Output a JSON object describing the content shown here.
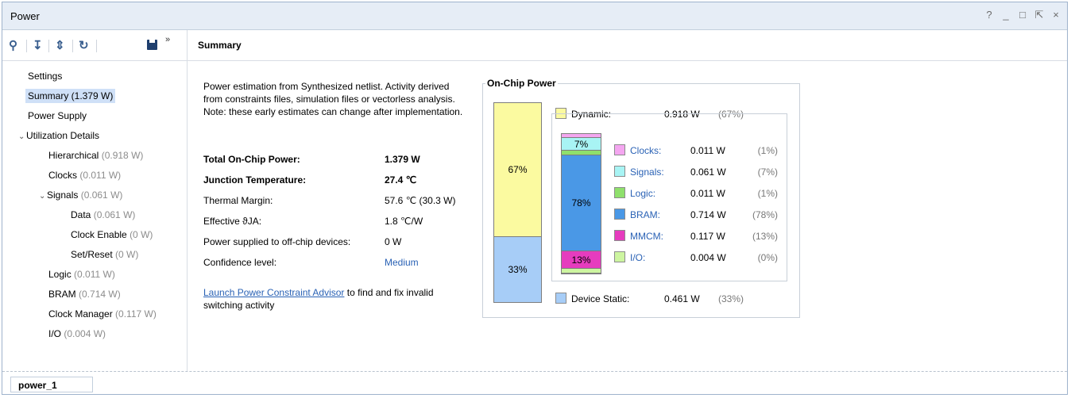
{
  "window": {
    "title": "Power",
    "controls": [
      "?",
      "_",
      "□",
      "⇱",
      "×"
    ]
  },
  "main": {
    "header": "Summary"
  },
  "tree": [
    {
      "label": "Settings",
      "sub": ""
    },
    {
      "label": "Summary (1.379 W)",
      "sub": ""
    },
    {
      "label": "Power Supply",
      "sub": ""
    },
    {
      "label": "Utilization Details",
      "sub": ""
    },
    {
      "label": "Hierarchical",
      "sub": "(0.918 W)"
    },
    {
      "label": "Clocks",
      "sub": "(0.011 W)"
    },
    {
      "label": "Signals",
      "sub": "(0.061 W)"
    },
    {
      "label": "Data",
      "sub": "(0.061 W)"
    },
    {
      "label": "Clock Enable",
      "sub": "(0 W)"
    },
    {
      "label": "Set/Reset",
      "sub": "(0 W)"
    },
    {
      "label": "Logic",
      "sub": "(0.011 W)"
    },
    {
      "label": "BRAM",
      "sub": "(0.714 W)"
    },
    {
      "label": "Clock Manager",
      "sub": "(0.117 W)"
    },
    {
      "label": "I/O",
      "sub": "(0.004 W)"
    }
  ],
  "summary": {
    "description": "Power estimation from Synthesized netlist. Activity derived from constraints files, simulation files or vectorless analysis. Note: these early estimates can change after implementation.",
    "rows": [
      {
        "label": "Total On-Chip Power:",
        "value": "1.379 W"
      },
      {
        "label": "Junction Temperature:",
        "value": "27.4 ℃"
      },
      {
        "label": "Thermal Margin:",
        "value": "57.6 ℃ (30.3 W)"
      },
      {
        "label": "Effective ϑJA:",
        "value": "1.8 ℃/W"
      },
      {
        "label": "Power supplied to off-chip devices:",
        "value": "0 W"
      },
      {
        "label": "Confidence level:",
        "value": "Medium"
      }
    ],
    "advisor_link": "Launch Power Constraint Advisor",
    "advisor_text": " to find and fix invalid switching activity"
  },
  "onchip": {
    "title": "On-Chip Power",
    "dynamic": {
      "label": "Dynamic:",
      "value": "0.918 W",
      "pct": "(67%)",
      "bar_pct": "67%"
    },
    "static": {
      "label": "Device Static:",
      "value": "0.461 W",
      "pct": "(33%)",
      "bar_pct": "33%"
    },
    "components": [
      {
        "label": "Clocks:",
        "value": "0.011 W",
        "pct": "(1%)",
        "color": "#f4a6f0"
      },
      {
        "label": "Signals:",
        "value": "0.061 W",
        "pct": "(7%)",
        "color": "#a8f4f4"
      },
      {
        "label": "Logic:",
        "value": "0.011 W",
        "pct": "(1%)",
        "color": "#8fe06c"
      },
      {
        "label": "BRAM:",
        "value": "0.714 W",
        "pct": "(78%)",
        "color": "#4a98e6"
      },
      {
        "label": "MMCM:",
        "value": "0.117 W",
        "pct": "(13%)",
        "color": "#e63cbe"
      },
      {
        "label": "I/O:",
        "value": "0.004 W",
        "pct": "(0%)",
        "color": "#cdf5a0"
      }
    ],
    "bar_labels": {
      "signals": "7%",
      "bram": "78%",
      "mmcm": "13%"
    },
    "colors": {
      "dynamic": "#fbfaa0",
      "static": "#a7cdf7"
    }
  },
  "bottom_tab": "power_1"
}
